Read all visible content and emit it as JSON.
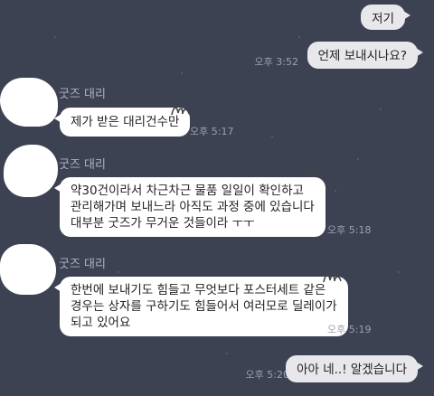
{
  "messages": [
    {
      "id": "m1",
      "side": "mine",
      "text": "저기"
    },
    {
      "id": "m2",
      "side": "mine",
      "text": "언제 보내시나요?",
      "time": "오후 3:52"
    },
    {
      "id": "m3",
      "side": "theirs",
      "sender": "굿즈 대리",
      "text": "제가 받은 대리건수만",
      "time": "오후 5:17"
    },
    {
      "id": "m4",
      "side": "theirs",
      "sender": "굿즈 대리",
      "lines": [
        "약30건이라서 차근차근 물품 일일이 확인하고",
        "관리해가며 보내느라 아직도 과정 중에 있습니다",
        "대부분 굿즈가 무거운 것들이라 ㅜㅜ"
      ],
      "time": "오후 5:18"
    },
    {
      "id": "m5",
      "side": "theirs",
      "sender": "굿즈 대리",
      "lines": [
        "한번에 보내기도 힘들고 무엇보다 포스터세트 같은",
        "경우는 상자를 구하기도 힘들어서 여러모로 딜레이가",
        "되고 있어요"
      ],
      "time": "오후 5:19"
    },
    {
      "id": "m6",
      "side": "mine",
      "text": "아아 네..! 알겠습니다",
      "time": "오후 5:20"
    }
  ],
  "colors": {
    "background": "#3c4252",
    "mine_bubble": "#e8e8ec",
    "theirs_bubble": "#ffffff",
    "time_text": "#9aa0ad",
    "sender_text": "#aeb3be"
  },
  "icons": {
    "avatar": "censored-avatar-blob",
    "bubble_censor": "scribble-censor-mark"
  }
}
